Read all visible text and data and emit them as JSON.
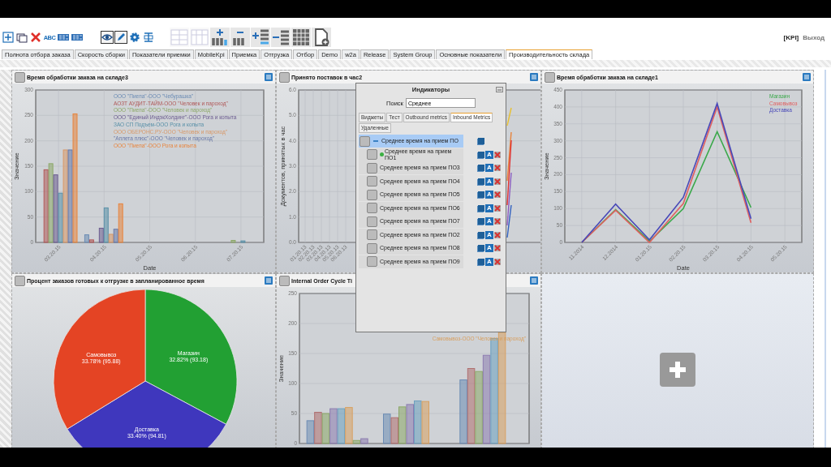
{
  "toolbar": {
    "tools": [
      {
        "kind": "add",
        "pressed": false
      },
      {
        "kind": "windows",
        "pressed": false
      },
      {
        "kind": "delete",
        "pressed": false
      },
      {
        "kind": "abc",
        "label": "ABC",
        "pressed": false
      },
      {
        "kind": "text_block",
        "pressed": false
      },
      {
        "kind": "text_block",
        "pressed": false
      },
      {
        "kind": "eye",
        "pressed": true
      },
      {
        "kind": "pencil",
        "pressed": true
      },
      {
        "kind": "gear",
        "pressed": false
      },
      {
        "kind": "text_field",
        "pressed": false
      }
    ],
    "layout_tools": [
      {
        "kind": "table_rows",
        "disabled": true
      },
      {
        "kind": "table_cols",
        "disabled": true
      },
      {
        "kind": "add_column",
        "disabled": false
      },
      {
        "kind": "remove_column",
        "disabled": false
      },
      {
        "kind": "add_row",
        "disabled": false
      },
      {
        "kind": "remove_row",
        "disabled": false
      },
      {
        "kind": "grid",
        "disabled": false
      },
      {
        "kind": "new_document",
        "disabled": false
      }
    ]
  },
  "top_links": {
    "kpi": "[KPI]",
    "logout": "Выход"
  },
  "tabs": [
    {
      "label": "Полнота отбора заказа",
      "selected": false
    },
    {
      "label": "Скорость сборки",
      "selected": false
    },
    {
      "label": "Показатели приемки",
      "selected": false
    },
    {
      "label": "MobileKpi",
      "selected": false
    },
    {
      "label": "Приемка",
      "selected": false
    },
    {
      "label": "Отгрузка",
      "selected": false
    },
    {
      "label": "Отбор",
      "selected": false
    },
    {
      "label": "Demo",
      "selected": false
    },
    {
      "label": "w2a",
      "selected": false
    },
    {
      "label": "Release",
      "selected": false
    },
    {
      "label": "System Group",
      "selected": false
    },
    {
      "label": "Основные показатели",
      "selected": false
    },
    {
      "label": "Производительность склада",
      "selected": true
    }
  ],
  "widgets": [
    {
      "kind": "bar_chart",
      "title": "Время обработки заказа на складе3",
      "chart_data": {
        "type": "bar",
        "grid": true,
        "xlabel": "Date",
        "ylabel": "Значение",
        "categories": [
          "03.20.15",
          "04.20.15",
          "05.20.15",
          "06.20.15",
          "07.20.15"
        ],
        "ylim": [
          0,
          300
        ],
        "yticks": [
          0,
          50,
          100,
          150,
          200,
          250,
          300
        ],
        "series": [
          {
            "name": "ООО \"Пиепа\"-ООО \"Чебурашка\"",
            "color": "#6c8cb4",
            "values": [
              null,
              15,
              null,
              null,
              null
            ]
          },
          {
            "name": "АОЗТ АУДИТ-ТАЙМ-ООО \"Человек и пароход\"",
            "color": "#b05858",
            "values": [
              143,
              5,
              null,
              null,
              null
            ]
          },
          {
            "name": "ООО \"Пиепа\"-ООО \"Человек и пароход\"",
            "color": "#8ca868",
            "values": [
              155,
              null,
              null,
              null,
              4
            ]
          },
          {
            "name": "ООО \"Единый ИндэкХолдинг\"-ООО Рога и копыта",
            "color": "#6c5c90",
            "values": [
              133,
              28,
              null,
              null,
              null
            ]
          },
          {
            "name": "ЗАО СП Подъем-ООО Рога и копыта",
            "color": "#5890a8",
            "values": [
              97,
              68,
              null,
              null,
              3
            ]
          },
          {
            "name": "ООО ОБЕРОНС.РУ-ООО \"Человек и пароход\"",
            "color": "#d89868",
            "values": [
              182,
              16,
              null,
              null,
              null
            ]
          },
          {
            "name": "\"Аплета плюс\"-ООО \"Человек и пароход\"",
            "color": "#6878a8",
            "values": [
              182,
              26,
              null,
              null,
              null
            ]
          },
          {
            "name": "ООО \"Пиепа\"-ООО Рога и копыта",
            "color": "#e8843c",
            "values": [
              253,
              76,
              null,
              null,
              null
            ]
          }
        ]
      }
    },
    {
      "kind": "covered_line_chart",
      "title": "Принято поставок в час2",
      "axis": {
        "ylabel": "Документов, принятых в час",
        "yticks": [
          "6.0",
          "5.0",
          "4.0",
          "3.0",
          "2.0",
          "1.0",
          "0.0"
        ],
        "xticks": [
          "01.20.13",
          "02.20.13",
          "03.20.13",
          "04.20.13",
          "05.20.13",
          "06.20.13"
        ]
      }
    },
    {
      "kind": "line_chart",
      "title": "Время обработки заказа на складе1",
      "chart_data": {
        "type": "line",
        "grid": true,
        "xlabel": "Date",
        "ylabel": "Значение",
        "categories": [
          "11.2014",
          "12.2014",
          "01.20.15",
          "02.20.15",
          "03.20.15",
          "04.20.15",
          "05.20.15"
        ],
        "ylim": [
          0,
          450
        ],
        "yticks": [
          0,
          50,
          100,
          150,
          200,
          250,
          300,
          350,
          400,
          450
        ],
        "series": [
          {
            "name": "Магазин",
            "color": "#3aa84a",
            "values": [
              0,
              97,
              3,
              100,
              327,
              103,
              null
            ]
          },
          {
            "name": "Самовывоз",
            "color": "#e06060",
            "values": [
              0,
              95,
              0,
              115,
              400,
              58,
              null
            ]
          },
          {
            "name": "Доставка",
            "color": "#4848b8",
            "values": [
              0,
              113,
              8,
              133,
              410,
              70,
              null
            ]
          }
        ]
      }
    },
    {
      "kind": "pie_chart",
      "title": "Процент заказов готовых к отгрузке в запланированное время",
      "chart_data": {
        "type": "pie",
        "categories": [
          "Магазин",
          "Доставка",
          "Самовывоз"
        ],
        "series": [
          {
            "values": [
              32.82,
              33.4,
              33.78
            ]
          }
        ],
        "colors": [
          "#22a033",
          "#3f37bd",
          "#e44424"
        ],
        "value_labels": [
          "32.82% (93.18)",
          "33.40% (94.81)",
          "33.78% (95.88)"
        ]
      }
    },
    {
      "kind": "covered_bar_chart",
      "title": "Internal Order Cycle Ti",
      "chart_data": {
        "type": "bar",
        "grid": true,
        "ylabel": "Значение",
        "ylim": [
          0,
          250
        ],
        "yticks": [
          0,
          50,
          100,
          150,
          200,
          250
        ],
        "series": [
          {
            "color": "#6c8cb4",
            "values": [
              38,
              49,
              106
            ]
          },
          {
            "color": "#b07070",
            "values": [
              52,
              43,
              125
            ]
          },
          {
            "color": "#8ca868",
            "values": [
              50,
              61,
              120
            ]
          },
          {
            "color": "#8c7cb0",
            "values": [
              58,
              65,
              147
            ]
          },
          {
            "color": "#6ca0c0",
            "values": [
              58,
              71,
              175
            ]
          },
          {
            "name": "Самовывоз-ООО \"Человек и пароход\"",
            "color": "#d8a060",
            "values": [
              60,
              70,
              185
            ]
          },
          {
            "color": "#8ca868",
            "values": [
              5,
              null,
              null
            ]
          },
          {
            "color": "#8c7cb0",
            "values": [
              8,
              null,
              null
            ]
          }
        ]
      }
    },
    {
      "kind": "empty"
    }
  ],
  "dialog": {
    "title": "Индикаторы",
    "search_label": "Поиск",
    "search_value": "Среднее",
    "tabs": [
      {
        "label": "Виджеты",
        "selected": false
      },
      {
        "label": "Тест",
        "selected": false
      },
      {
        "label": "Outbound metrics",
        "selected": false
      },
      {
        "label": "Inbound Metrics",
        "selected": true
      },
      {
        "label": "Удаленные",
        "selected": false
      }
    ],
    "tree": [
      {
        "label": "Среднее время на прием ПО",
        "expanded": true,
        "selected": true,
        "children": [
          {
            "label": "Среднее время на прием ПО1",
            "online": true,
            "action_letter": "A"
          },
          {
            "label": "Среднее время на прием ПО3",
            "online": false,
            "action_letter": "A"
          },
          {
            "label": "Среднее время на прием ПО4",
            "online": false,
            "action_letter": "A"
          },
          {
            "label": "Среднее время на прием ПО5",
            "online": false,
            "action_letter": "A"
          },
          {
            "label": "Среднее время на прием ПО6",
            "online": false,
            "action_letter": "A"
          },
          {
            "label": "Среднее время на прием ПО7",
            "online": false,
            "action_letter": "A"
          },
          {
            "label": "Среднее время на прием ПО2",
            "online": false,
            "action_letter": "A"
          },
          {
            "label": "Среднее время на прием ПО8",
            "online": false,
            "action_letter": "A"
          },
          {
            "label": "Среднее время на прием ПО9",
            "online": false,
            "action_letter": "A"
          }
        ]
      }
    ]
  }
}
